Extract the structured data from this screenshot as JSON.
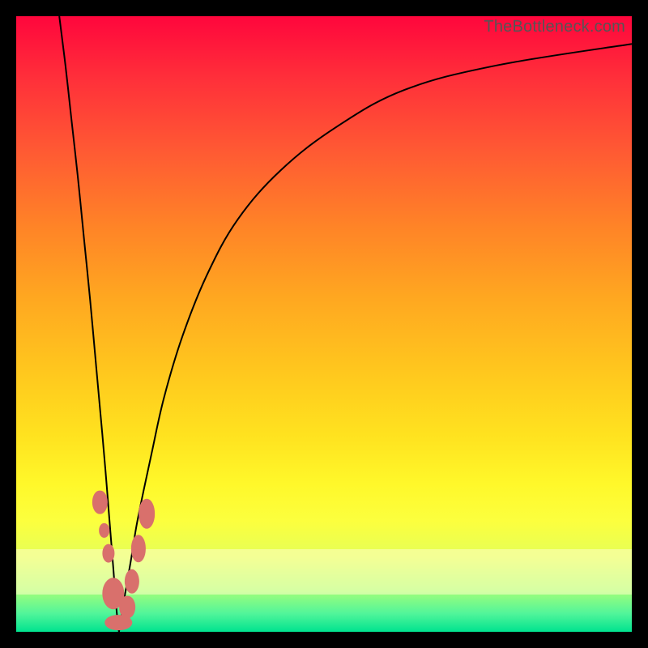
{
  "attribution": "TheBottleneck.com",
  "colors": {
    "frame": "#000000",
    "blob": "#d9706c",
    "curve": "#000000"
  },
  "chart_data": {
    "type": "line",
    "title": "",
    "xlabel": "",
    "ylabel": "",
    "xlim": [
      0,
      100
    ],
    "ylim": [
      0,
      100
    ],
    "series": [
      {
        "name": "left-branch",
        "x": [
          7,
          8,
          9,
          10,
          11,
          12,
          13,
          14,
          14.6,
          15,
          15.4,
          15.8,
          16.1,
          16.35,
          16.55,
          16.7
        ],
        "y": [
          100,
          92,
          83,
          74,
          64,
          54,
          43,
          32,
          25,
          20,
          15,
          10,
          6,
          3,
          1,
          0
        ]
      },
      {
        "name": "right-branch",
        "x": [
          16.7,
          17,
          17.5,
          18,
          18.7,
          19.5,
          20.5,
          22,
          24,
          27,
          31,
          36,
          43,
          52,
          63,
          78,
          100
        ],
        "y": [
          0,
          2,
          5,
          8,
          12,
          17,
          22,
          29,
          38,
          48,
          58,
          67,
          75,
          82,
          88,
          92,
          95.5
        ]
      }
    ],
    "markers": [
      {
        "name": "blob-1",
        "x": 13.6,
        "y": 21,
        "rx": 1.2,
        "ry": 1.9
      },
      {
        "name": "blob-2",
        "x": 14.3,
        "y": 16.5,
        "rx": 0.9,
        "ry": 1.2
      },
      {
        "name": "blob-3",
        "x": 15.0,
        "y": 12.8,
        "rx": 1.0,
        "ry": 1.5
      },
      {
        "name": "blob-4",
        "x": 15.8,
        "y": 6.2,
        "rx": 1.8,
        "ry": 2.6
      },
      {
        "name": "blob-5",
        "x": 16.6,
        "y": 1.5,
        "rx": 2.2,
        "ry": 1.3
      },
      {
        "name": "blob-6",
        "x": 18.0,
        "y": 4.0,
        "rx": 1.3,
        "ry": 1.9
      },
      {
        "name": "blob-7",
        "x": 18.8,
        "y": 8.2,
        "rx": 1.2,
        "ry": 2.0
      },
      {
        "name": "blob-8",
        "x": 19.9,
        "y": 13.5,
        "rx": 1.2,
        "ry": 2.2
      },
      {
        "name": "blob-9",
        "x": 21.2,
        "y": 19.2,
        "rx": 1.3,
        "ry": 2.4
      }
    ]
  }
}
